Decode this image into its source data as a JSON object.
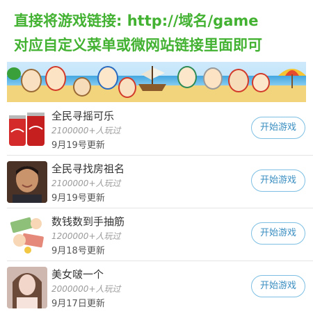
{
  "header": {
    "line1": "直接将游戏链接: http://域名/game",
    "line2": "对应自定义菜单或微网站链接里面即可",
    "color": "#43b232"
  },
  "banner": {
    "image": "beach-pirate-cartoon-banner"
  },
  "games": [
    {
      "title": "全民寻摇可乐",
      "players": "2100000+人玩过",
      "date": "9月19号更新",
      "button": "开始游戏",
      "thumb": "cola-cans"
    },
    {
      "title": "全民寻找房祖名",
      "players": "2100000+人玩过",
      "date": "9月19号更新",
      "button": "开始游戏",
      "thumb": "man-portrait"
    },
    {
      "title": "数钱数到手抽筋",
      "players": "1200000+人玩过",
      "date": "9月18号更新",
      "button": "开始游戏",
      "thumb": "money-cartoon"
    },
    {
      "title": "美女啵一个",
      "players": "2000000+人玩过",
      "date": "9月17日更新",
      "button": "开始游戏",
      "thumb": "woman-portrait"
    }
  ],
  "colors": {
    "button_border": "#7dbfe3",
    "button_text": "#3a8ec1",
    "title_text": "#333333",
    "players_text": "#9a9a9a"
  }
}
